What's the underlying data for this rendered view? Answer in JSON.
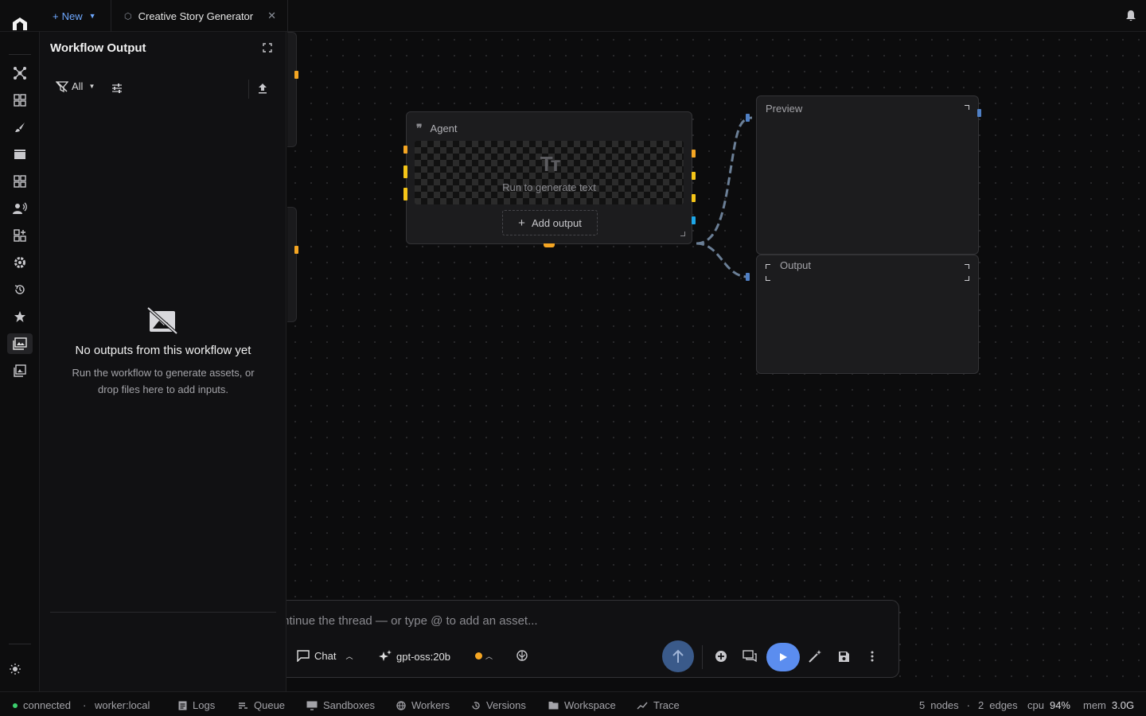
{
  "topbar": {
    "new_label": "New",
    "tab_title": "Creative Story Generator",
    "icons": {
      "logo": "app-logo",
      "bell": "bell-icon",
      "close": "close-icon"
    }
  },
  "rail": {
    "items": [
      "nodes",
      "templates",
      "brush",
      "media",
      "apps",
      "voice",
      "add-widget",
      "settings",
      "history",
      "favorites",
      "assets",
      "gallery"
    ],
    "active": "assets",
    "theme_icon": "sun-icon"
  },
  "output_panel": {
    "title": "Workflow Output",
    "filter_label": "All",
    "empty_title": "No outputs from this workflow yet",
    "empty_line1": "Run the workflow to generate assets, or",
    "empty_line2": "drop files here to add inputs."
  },
  "canvas": {
    "agent_node": {
      "title": "Agent",
      "placeholder": "Run to generate text",
      "placeholder_icon": "Tт",
      "add_output_label": "Add output"
    },
    "preview_node": {
      "title": "Preview"
    },
    "output_node": {
      "title": "Output"
    }
  },
  "composer": {
    "placeholder": "Continue the thread — or type @ to add an asset...",
    "mode_label": "Chat",
    "model_label": "gpt-oss:20b"
  },
  "statusbar": {
    "connection": "connected",
    "worker": "worker:local",
    "links": [
      "Logs",
      "Queue",
      "Sandboxes",
      "Workers",
      "Versions",
      "Workspace",
      "Trace"
    ],
    "nodes_count": "5",
    "nodes_label": "nodes",
    "edges_count": "2",
    "edges_label": "edges",
    "cpu_label": "cpu",
    "cpu_value": "94%",
    "mem_label": "mem",
    "mem_value": "3.0G"
  },
  "colors": {
    "accent": "#5b8def",
    "port_orange": "#f5a623",
    "port_yellow": "#f5c518",
    "port_blue": "#1ea7e8",
    "edge": "#6b7f96",
    "connected": "#3ccf6e"
  }
}
